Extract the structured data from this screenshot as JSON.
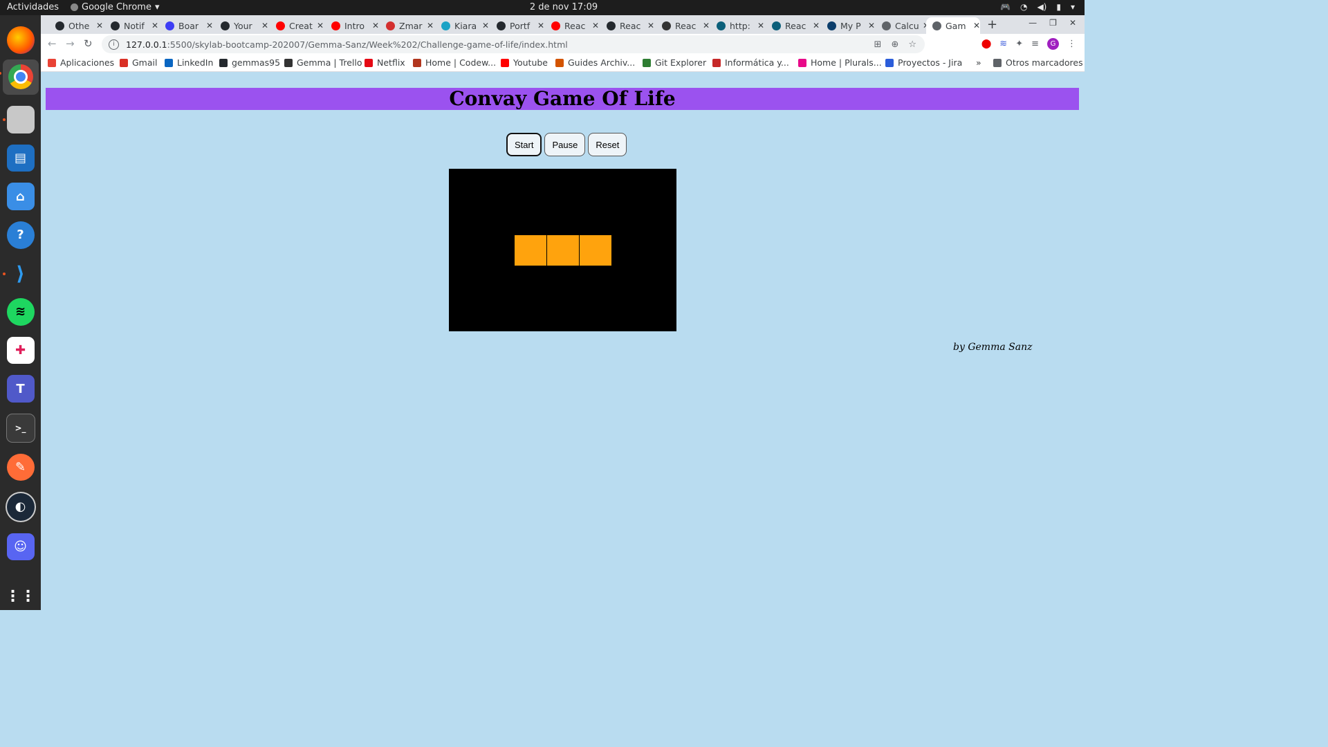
{
  "topbar": {
    "activities": "Actividades",
    "app_name": "Google Chrome",
    "clock": "2 de nov  17:09"
  },
  "tabs": [
    {
      "label": "Othe",
      "icon_color": "#24292e"
    },
    {
      "label": "Notif",
      "icon_color": "#24292e"
    },
    {
      "label": "Boar",
      "icon_color": "#3d3df5"
    },
    {
      "label": "Your",
      "icon_color": "#24292e"
    },
    {
      "label": "Creat",
      "icon_color": "#ff0000"
    },
    {
      "label": "Intro",
      "icon_color": "#ff0000"
    },
    {
      "label": "Zmar",
      "icon_color": "#d32f2f"
    },
    {
      "label": "Kiara",
      "icon_color": "#1ba3c6"
    },
    {
      "label": "Portf",
      "icon_color": "#24292e"
    },
    {
      "label": "Reac",
      "icon_color": "#ff0000"
    },
    {
      "label": "Reac",
      "icon_color": "#24292e"
    },
    {
      "label": "Reac",
      "icon_color": "#333333"
    },
    {
      "label": "http:",
      "icon_color": "#0b5f7a"
    },
    {
      "label": "Reac",
      "icon_color": "#0b5f7a"
    },
    {
      "label": "My P",
      "icon_color": "#0b3d6b"
    },
    {
      "label": "Calcu",
      "icon_color": "#5f6368"
    },
    {
      "label": "Gam",
      "icon_color": "#5f6368",
      "active": true
    }
  ],
  "address": {
    "host": "127.0.0.1",
    "path": ":5500/skylab-bootcamp-202007/Gemma-Sanz/Week%202/Challenge-game-of-life/index.html"
  },
  "bookmarks": [
    {
      "label": "Aplicaciones",
      "icon_color": "#e94235"
    },
    {
      "label": "Gmail",
      "icon_color": "#d93025"
    },
    {
      "label": "LinkedIn",
      "icon_color": "#0a66c2"
    },
    {
      "label": "gemmas95",
      "icon_color": "#24292e"
    },
    {
      "label": "Gemma | Trello",
      "icon_color": "#333333"
    },
    {
      "label": "Netflix",
      "icon_color": "#e50914"
    },
    {
      "label": "Home | Codew...",
      "icon_color": "#b1361e"
    },
    {
      "label": "Youtube",
      "icon_color": "#ff0000"
    },
    {
      "label": "Guides Archiv...",
      "icon_color": "#d35400"
    },
    {
      "label": "Git Explorer",
      "icon_color": "#2e7d32"
    },
    {
      "label": "Informática y...",
      "icon_color": "#c62828"
    },
    {
      "label": "Home | Plurals...",
      "icon_color": "#e80a89"
    },
    {
      "label": "Proyectos - Jira",
      "icon_color": "#2b5dda"
    }
  ],
  "other_bookmarks": "Otros marcadores",
  "page": {
    "title": "Convay Game Of Life",
    "buttons": {
      "start": "Start",
      "pause": "Pause",
      "reset": "Reset"
    },
    "credit": "by Gemma Sanz",
    "alive_color": "#ffa30d",
    "board_color": "#000000",
    "header_color": "#9b52ef",
    "background_color": "#b9dcf0"
  }
}
